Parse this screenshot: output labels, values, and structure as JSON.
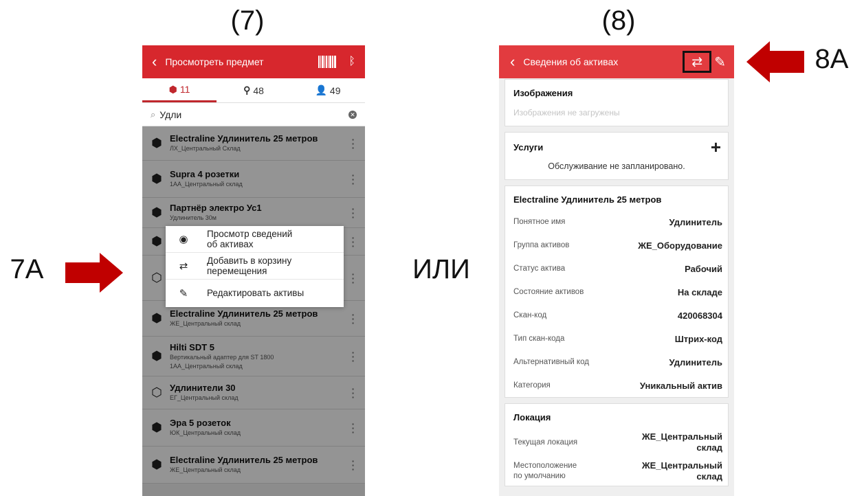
{
  "captions": {
    "left": "(7)",
    "right": "(8)",
    "or": "ИЛИ",
    "label_7a": "7A",
    "label_8a": "8A"
  },
  "screen7": {
    "header": {
      "title": "Просмотреть предмет",
      "back_icon": "chevron-left",
      "barcode_icon": "barcode",
      "bluetooth_icon": "bluetooth"
    },
    "tabs": [
      {
        "icon": "cube-icon",
        "count": "11"
      },
      {
        "icon": "map-pin-icon",
        "count": "48"
      },
      {
        "icon": "user-icon",
        "count": "49"
      }
    ],
    "search": {
      "value": "Удли"
    },
    "items": [
      {
        "name": "Electraline Удлинитель 25 метров",
        "sub": "ЛХ_Центральный Склад",
        "icon": "cube"
      },
      {
        "name": "Supra 4 розетки",
        "sub": "1АА_Центральный склад",
        "icon": "cube"
      },
      {
        "name": "Партнёр электро Ус1",
        "sub": "Удлинитель 30м",
        "icon": "cube"
      },
      {
        "name": "",
        "sub": "",
        "icon": "cube"
      },
      {
        "name": "",
        "sub": "",
        "icon": "cubes"
      },
      {
        "name": "Electraline Удлинитель 25 метров",
        "sub": "ЖЕ_Центральный склад",
        "icon": "cube"
      },
      {
        "name": "Hilti SDT 5",
        "sub": "Вертикальный адаптер для ST 1800",
        "sub2": "1АА_Центральный склад",
        "icon": "cube"
      },
      {
        "name": "Удлинители 30",
        "sub": "ЕГ_Центральный склад",
        "icon": "cubes"
      },
      {
        "name": "Эра 5 розеток",
        "sub": "ЮК_Центральный склад",
        "icon": "cube"
      },
      {
        "name": "Electraline Удлинитель 25 метров",
        "sub": "ЖЕ_Центральный склад",
        "icon": "cube"
      }
    ],
    "popup": [
      {
        "icon": "eye-icon",
        "label": "Просмотр сведений\nоб активах"
      },
      {
        "icon": "swap-icon",
        "label": "Добавить в корзину\nперемещения"
      },
      {
        "icon": "pencil-icon",
        "label": "Редактировать активы"
      }
    ]
  },
  "screen8": {
    "header": {
      "title": "Сведения об активах"
    },
    "images": {
      "title": "Изображения",
      "empty": "Изображения не загружены"
    },
    "services": {
      "title": "Услуги",
      "empty": "Обслуживание не запланировано."
    },
    "asset": {
      "title": "Electraline Удлинитель 25 метров",
      "fields": [
        {
          "k": "Понятное имя",
          "v": "Удлинитель"
        },
        {
          "k": "Группа активов",
          "v": "ЖЕ_Оборудование"
        },
        {
          "k": "Статус актива",
          "v": "Рабочий"
        },
        {
          "k": "Состояние активов",
          "v": "На складе"
        },
        {
          "k": "Скан-код",
          "v": "420068304"
        },
        {
          "k": "Тип скан-кода",
          "v": "Штрих-код"
        },
        {
          "k": "Альтернативный код",
          "v": "Удлинитель"
        },
        {
          "k": "Категория",
          "v": "Уникальный актив"
        }
      ]
    },
    "location": {
      "title": "Локация",
      "fields": [
        {
          "k": "Текущая локация",
          "v": "ЖЕ_Центральный\nсклад"
        },
        {
          "k": "Местоположение\nпо умолчанию",
          "v": "ЖЕ_Центральный\nсклад"
        }
      ]
    }
  },
  "colors": {
    "brand_red": "#d7272d",
    "arrow_red": "#c00000"
  }
}
